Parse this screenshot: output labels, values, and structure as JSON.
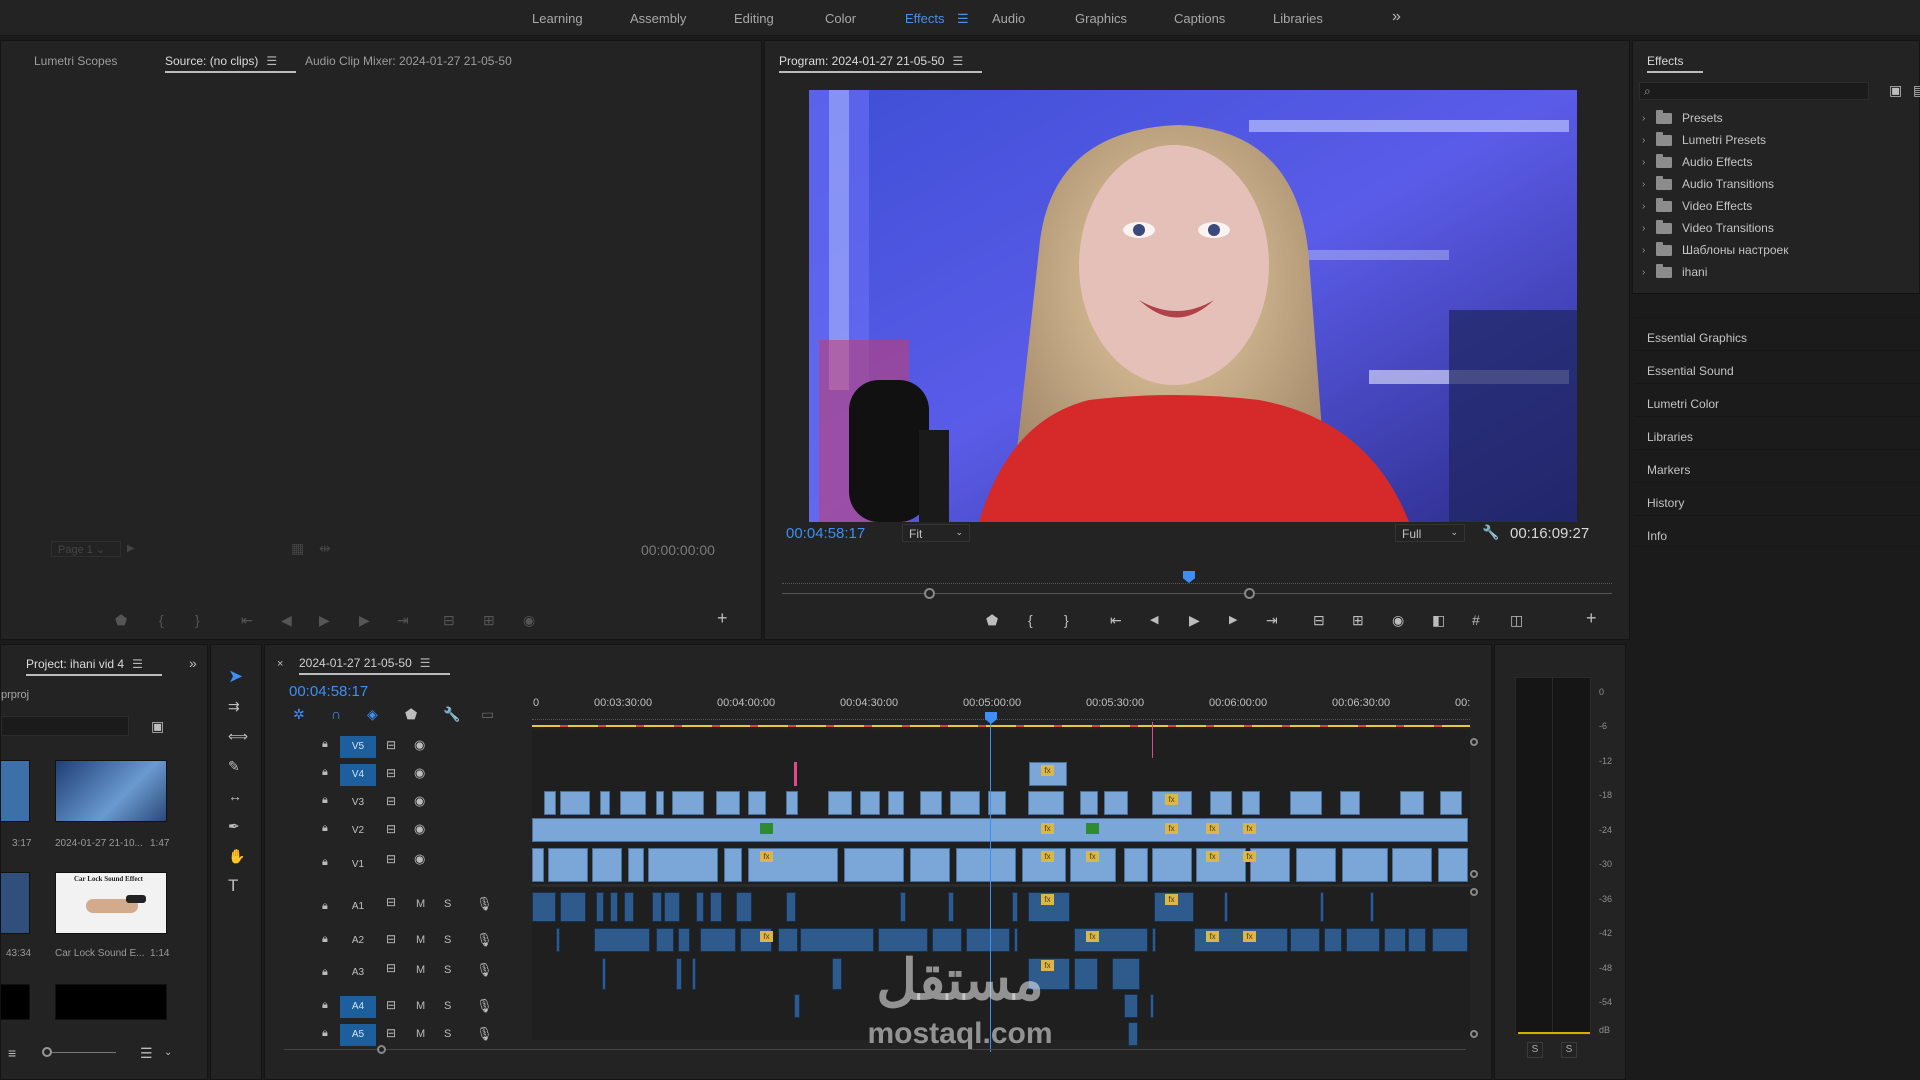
{
  "workspace_tabs": [
    "Learning",
    "Assembly",
    "Editing",
    "Color",
    "Effects",
    "Audio",
    "Graphics",
    "Captions",
    "Libraries"
  ],
  "active_workspace": "Effects",
  "source_panel": {
    "tabs": [
      "Lumetri Scopes",
      "Source: (no clips)",
      "Audio Clip Mixer: 2024-01-27 21-05-50"
    ],
    "timecode": "00:00:00:00",
    "page": "Page 1"
  },
  "program_panel": {
    "title": "Program: 2024-01-27 21-05-50",
    "timecode": "00:04:58:17",
    "zoom": "Fit",
    "resolution": "Full",
    "duration": "00:16:09:27"
  },
  "effects_panel": {
    "title": "Effects",
    "search_placeholder": "",
    "items": [
      "Presets",
      "Lumetri Presets",
      "Audio Effects",
      "Audio Transitions",
      "Video Effects",
      "Video Transitions",
      "Шаблоны настроек",
      "ihani"
    ],
    "side_panels": [
      "Essential Graphics",
      "Essential Sound",
      "Lumetri Color",
      "Libraries",
      "Markers",
      "History",
      "Info"
    ]
  },
  "project_panel": {
    "title": "Project: ihani vid 4",
    "file_ext": "prproj",
    "items": [
      {
        "name": "",
        "duration": "3:17"
      },
      {
        "name": "2024-01-27 21-10...",
        "duration": "1:47"
      },
      {
        "name": "",
        "duration": "43:34"
      },
      {
        "name": "Car Lock Sound E...",
        "duration": "1:14"
      }
    ],
    "car_thumb_caption": "Car Lock Sound Effect"
  },
  "timeline": {
    "sequence": "2024-01-27 21-05-50",
    "timecode": "00:04:58:17",
    "ruler": [
      "00:03:30:00",
      "00:04:00:00",
      "00:04:30:00",
      "00:05:00:00",
      "00:05:30:00",
      "00:06:00:00",
      "00:06:30:00",
      "00:"
    ],
    "video_tracks": [
      "V5",
      "V4",
      "V3",
      "V2",
      "V1"
    ],
    "audio_tracks": [
      "A1",
      "A2",
      "A3",
      "A4",
      "A5"
    ],
    "mute_label": "M",
    "solo_label": "S"
  },
  "meter": {
    "scale": [
      "0",
      "-6",
      "-12",
      "-18",
      "-24",
      "-30",
      "-36",
      "-42",
      "-48",
      "-54",
      "dB"
    ],
    "solo_buttons": [
      "S",
      "S"
    ]
  },
  "watermark": {
    "arabic": "مستقل",
    "latin": "mostaql.com"
  },
  "colors": {
    "accent": "#3e8ef5",
    "clip_video": "#7ba7d8",
    "clip_audio": "#2e5a8c",
    "fx_badge": "#d9b74a"
  }
}
